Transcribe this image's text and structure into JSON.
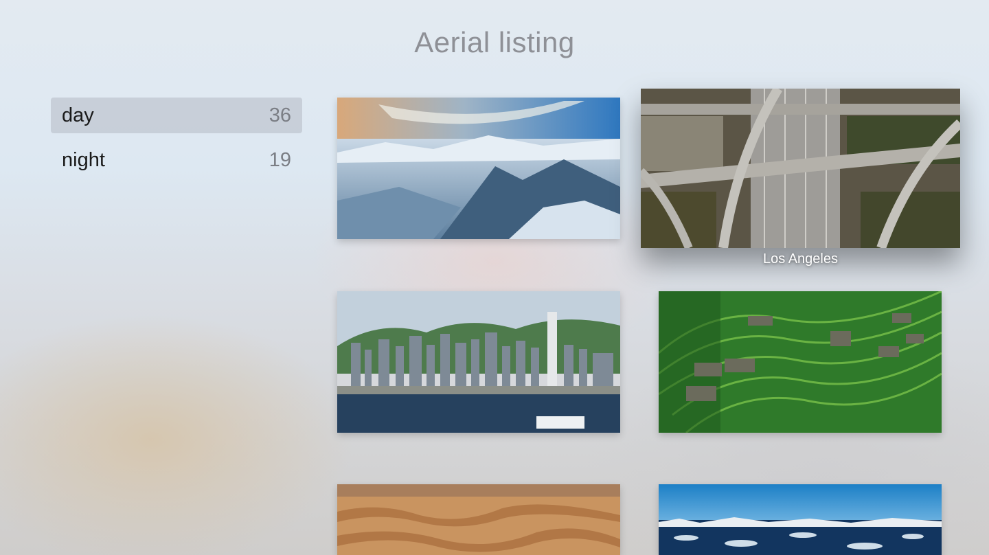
{
  "title": "Aerial listing",
  "sidebar": {
    "items": [
      {
        "label": "day",
        "count": "36",
        "selected": true
      },
      {
        "label": "night",
        "count": "19",
        "selected": false
      }
    ]
  },
  "grid": {
    "focused_caption": "Los Angeles"
  },
  "colors": {
    "title": "#8e9096",
    "selected_row": "#b4bac4",
    "count_text": "#7b7e85"
  }
}
